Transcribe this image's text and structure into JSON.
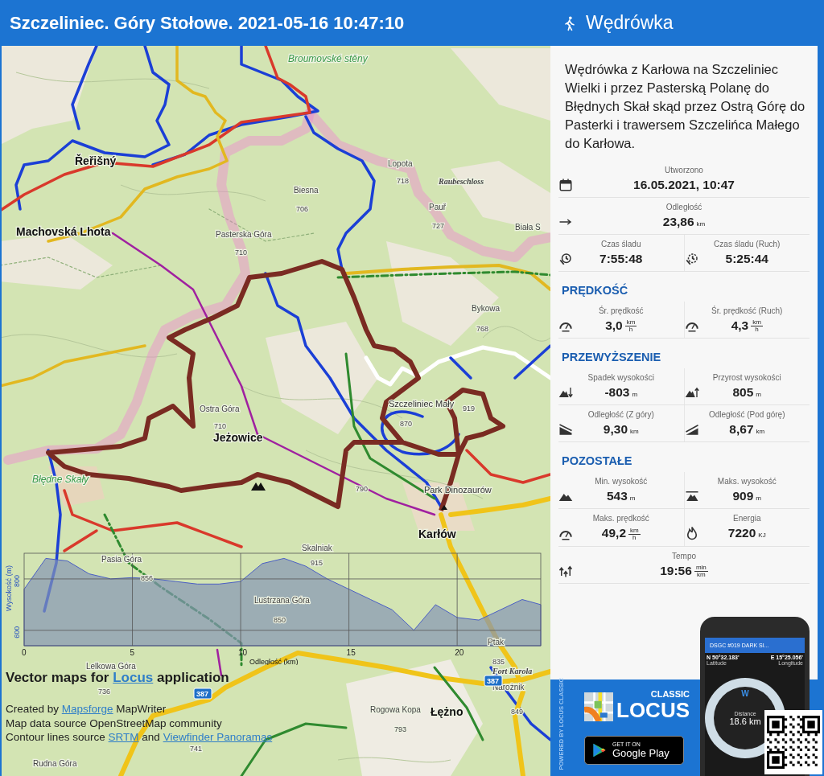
{
  "header": {
    "title": "Szczeliniec. Góry Stołowe. 2021-05-16 10:47:10",
    "panel_title": "Wędrówka"
  },
  "map": {
    "labels": [
      {
        "text": "Broumovské stěny",
        "kind": "area"
      },
      {
        "text": "Řeřišný",
        "kind": "town"
      },
      {
        "text": "Machovská Lhota",
        "kind": "town"
      },
      {
        "text": "Lopota",
        "kind": "peak"
      },
      {
        "text": "718",
        "kind": "elevation"
      },
      {
        "text": "Raubeschloss",
        "kind": "ruin"
      },
      {
        "text": "Biesna",
        "kind": "peak"
      },
      {
        "text": "706",
        "kind": "elevation"
      },
      {
        "text": "Pauř",
        "kind": "peak"
      },
      {
        "text": "727",
        "kind": "elevation"
      },
      {
        "text": "Pasterska Góra",
        "kind": "peak"
      },
      {
        "text": "710",
        "kind": "elevation"
      },
      {
        "text": "Biała S",
        "kind": "peak"
      },
      {
        "text": "Bykowa",
        "kind": "peak"
      },
      {
        "text": "768",
        "kind": "elevation"
      },
      {
        "text": "Ostra Góra",
        "kind": "peak"
      },
      {
        "text": "710",
        "kind": "elevation"
      },
      {
        "text": "Jeżowice",
        "kind": "town"
      },
      {
        "text": "Szczeliniec Mały",
        "kind": "poi"
      },
      {
        "text": "870",
        "kind": "elevation"
      },
      {
        "text": "919",
        "kind": "elevation"
      },
      {
        "text": "Błędne Skały",
        "kind": "area"
      },
      {
        "text": "Park Dinozaurów",
        "kind": "poi"
      },
      {
        "text": "790",
        "kind": "elevation"
      },
      {
        "text": "Karłów",
        "kind": "town"
      },
      {
        "text": "Skalniak",
        "kind": "peak"
      },
      {
        "text": "915",
        "kind": "elevation"
      },
      {
        "text": "Pasia Góra",
        "kind": "peak"
      },
      {
        "text": "856",
        "kind": "elevation"
      },
      {
        "text": "Lustrzana Góra",
        "kind": "peak"
      },
      {
        "text": "850",
        "kind": "elevation"
      },
      {
        "text": "Ptak",
        "kind": "peak"
      },
      {
        "text": "835",
        "kind": "elevation"
      },
      {
        "text": "Fort Karola",
        "kind": "ruin"
      },
      {
        "text": "Narożnik",
        "kind": "peak"
      },
      {
        "text": "849",
        "kind": "elevation"
      },
      {
        "text": "Lelkowa Góra",
        "kind": "peak"
      },
      {
        "text": "736",
        "kind": "elevation"
      },
      {
        "text": "741",
        "kind": "elevation"
      },
      {
        "text": "Rogowa Kopa",
        "kind": "peak"
      },
      {
        "text": "793",
        "kind": "elevation"
      },
      {
        "text": "Łężno",
        "kind": "town"
      },
      {
        "text": "Rudna Góra",
        "kind": "peak"
      },
      {
        "text": "387",
        "kind": "road"
      },
      {
        "text": "387",
        "kind": "road"
      }
    ],
    "chart_data": {
      "type": "area",
      "xlabel": "Odległość (km)",
      "ylabel": "Wysokość (m)",
      "x": [
        0,
        1,
        2,
        3,
        4,
        5,
        6,
        7,
        8,
        9,
        10,
        11,
        12,
        13,
        14,
        15,
        16,
        17,
        18,
        19,
        20,
        21,
        22,
        23,
        23.86
      ],
      "grid": true,
      "series": [
        {
          "color": "#8595b5",
          "values": [
            760,
            880,
            870,
            820,
            800,
            805,
            800,
            790,
            780,
            780,
            790,
            860,
            880,
            850,
            800,
            760,
            720,
            680,
            600,
            700,
            650,
            640,
            680,
            720,
            700
          ]
        }
      ],
      "xlim": [
        0,
        23.86
      ],
      "ylim": [
        540,
        900
      ],
      "xticks": [
        0,
        5,
        10,
        15,
        20
      ],
      "yticks": [
        600,
        800
      ]
    },
    "attribution": {
      "headline": [
        {
          "text": "Vector maps for ",
          "link": false
        },
        {
          "text": "Locus",
          "link": true
        },
        {
          "text": " application",
          "link": false
        }
      ],
      "lines": [
        [
          {
            "text": "Created by ",
            "link": false
          },
          {
            "text": "Mapsforge",
            "link": true
          },
          {
            "text": " MapWriter",
            "link": false
          }
        ],
        [
          {
            "text": "Map data source OpenStreetMap community",
            "link": false
          }
        ],
        [
          {
            "text": "Contour lines source ",
            "link": false
          },
          {
            "text": "SRTM",
            "link": true
          },
          {
            "text": " and ",
            "link": false
          },
          {
            "text": "Viewfinder Panoramas",
            "link": true
          }
        ]
      ]
    }
  },
  "description": "Wędrówka z Karłowa na Szczeliniec Wielki i przez Pasterską Polanę do Błędnych Skał skąd przez Ostrą Górę do Pasterki i trawersem Szczelińca Małego do Karłowa.",
  "stats": [
    {
      "kind": "full",
      "label": "Utworzono",
      "value": "16.05.2021, 10:47"
    },
    {
      "kind": "full",
      "label": "Odległość",
      "value": "23,86",
      "unit": "km"
    },
    {
      "kind": "pair",
      "cells": [
        {
          "label": "Czas śladu",
          "value": "7:55:48"
        },
        {
          "label": "Czas śladu (Ruch)",
          "value": "5:25:44"
        }
      ]
    },
    {
      "kind": "heading",
      "text": "PRĘDKOŚĆ"
    },
    {
      "kind": "pair",
      "cells": [
        {
          "label": "Śr. prędkość",
          "value": "3,0",
          "unit_fraction": [
            "km",
            "h"
          ]
        },
        {
          "label": "Śr. prędkość (Ruch)",
          "value": "4,3",
          "unit_fraction": [
            "km",
            "h"
          ]
        }
      ]
    },
    {
      "kind": "heading",
      "text": "PRZEWYŻSZENIE"
    },
    {
      "kind": "pair",
      "cells": [
        {
          "label": "Spadek wysokości",
          "value": "-803",
          "unit": "m"
        },
        {
          "label": "Przyrost wysokości",
          "value": "805",
          "unit": "m"
        }
      ]
    },
    {
      "kind": "pair",
      "cells": [
        {
          "label": "Odległość (Z góry)",
          "value": "9,30",
          "unit": "km"
        },
        {
          "label": "Odległość (Pod górę)",
          "value": "8,67",
          "unit": "km"
        }
      ]
    },
    {
      "kind": "heading",
      "text": "POZOSTAŁE"
    },
    {
      "kind": "pair",
      "cells": [
        {
          "label": "Min. wysokość",
          "value": "543",
          "unit": "m"
        },
        {
          "label": "Maks. wysokość",
          "value": "909",
          "unit": "m"
        }
      ]
    },
    {
      "kind": "pair",
      "cells": [
        {
          "label": "Maks. prędkość",
          "value": "49,2",
          "unit_fraction": [
            "km",
            "h"
          ]
        },
        {
          "label": "Energia",
          "value": "7220",
          "unit": "KJ"
        }
      ]
    },
    {
      "kind": "full",
      "label": "Tempo",
      "value": "19:56",
      "unit_fraction": [
        "min",
        "km"
      ]
    }
  ],
  "promo": {
    "vertical_text": "POWERED BY LOCUS CLASSIC",
    "logo_small": "CLASSIC",
    "logo_big": "LOCUS",
    "store_small": "GET IT ON",
    "store_big": "Google Play",
    "phone": {
      "title": "DSGC #019 DARK SI...",
      "latitude": "N 50°32.183'",
      "latitude_label": "Latitude",
      "longitude": "E 15°25.056'",
      "longitude_label": "Longitude",
      "compass_letter": "W",
      "distance_label": "Distance",
      "distance": "18.6 km"
    }
  }
}
